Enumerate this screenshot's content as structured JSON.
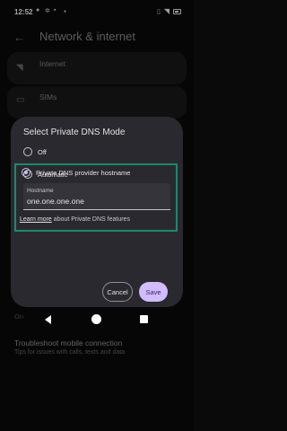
{
  "status_bar": {
    "time": "12:52",
    "left_icons": [
      "message-icon",
      "gear-icon",
      "chat-icon",
      "dot-icon"
    ],
    "right_icons": [
      "vibrate-icon",
      "wifi-icon",
      "battery-icon"
    ]
  },
  "page": {
    "title": "Network & internet",
    "items": [
      {
        "label": "Internet",
        "icon": "wifi-icon"
      },
      {
        "label": "SIMs",
        "icon": "sim-icon"
      }
    ],
    "on_text": "On",
    "troubleshoot": {
      "title": "Troubleshoot mobile connection",
      "subtitle": "Tips for issues with calls, texts and data"
    }
  },
  "dialog": {
    "title": "Select Private DNS Mode",
    "options": [
      {
        "label": "Off",
        "selected": false
      },
      {
        "label": "Automatic",
        "selected": false
      },
      {
        "label": "Private DNS provider hostname",
        "selected": true
      }
    ],
    "hostname_label": "Hostname",
    "hostname_value": "one.one.one.one",
    "learn_more_link": "Learn more",
    "learn_more_rest": " about Private DNS features",
    "cancel_label": "Cancel",
    "save_label": "Save",
    "highlight_color": "#1c8a6a",
    "accent_color": "#d0bcff"
  }
}
